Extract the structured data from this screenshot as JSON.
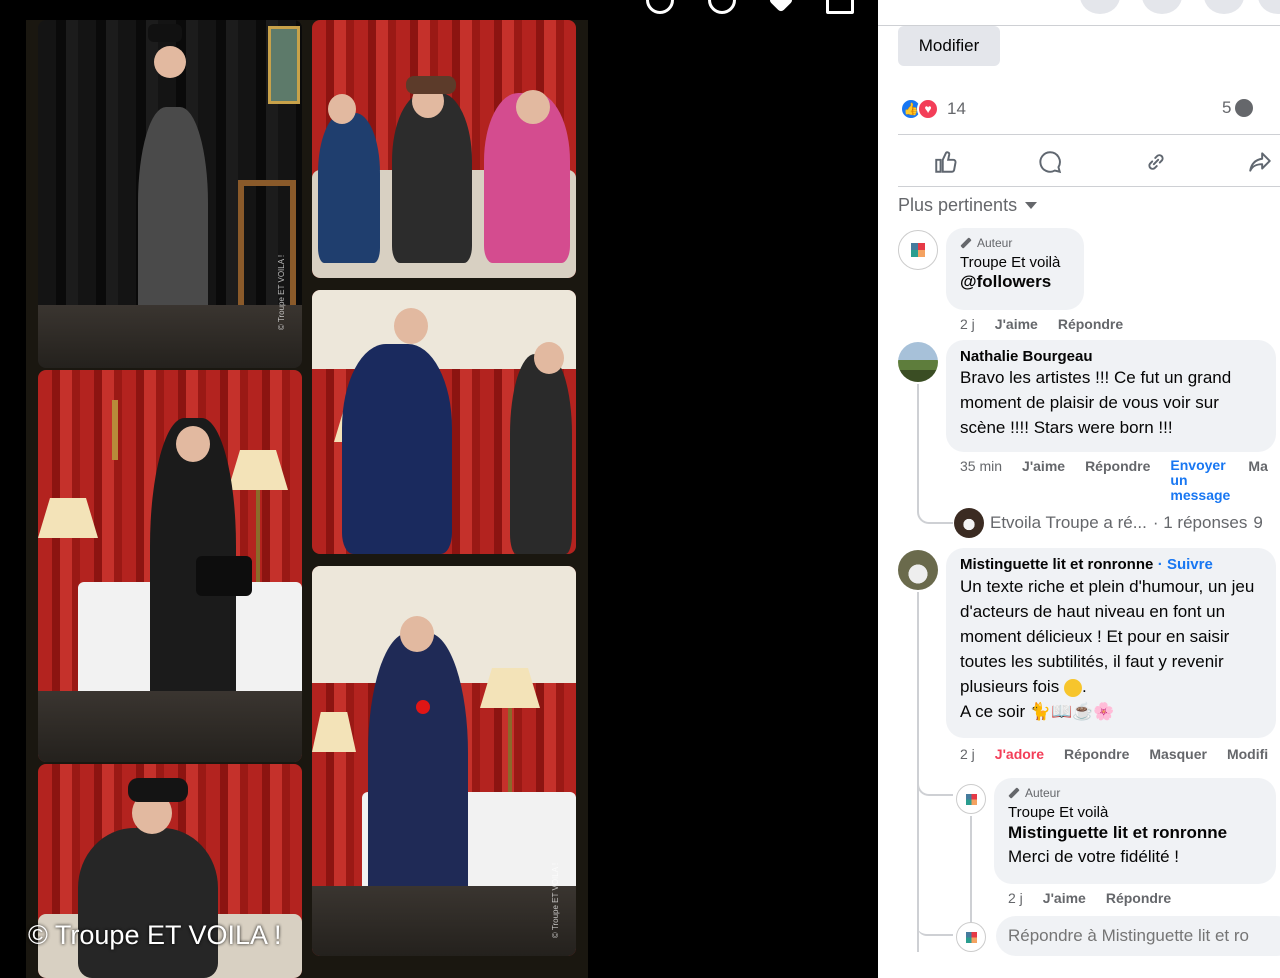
{
  "viewer": {
    "watermark": "© Troupe ET VOILA !",
    "photo_credit": "© Troupe ET VOILA !"
  },
  "post": {
    "edit_label": "Modifier",
    "reaction_count": "14",
    "comment_count": "5",
    "sort_label": "Plus pertinents"
  },
  "comments": [
    {
      "author_badge": "Auteur",
      "name": "Troupe Et voilà",
      "text": "@followers",
      "time": "2 j",
      "like": "J'aime",
      "reply": "Répondre"
    },
    {
      "name": "Nathalie Bourgeau",
      "text": "Bravo les artistes !!! Ce fut un grand moment de plaisir de vous voir sur scène !!!! Stars were born !!!",
      "time": "35 min",
      "like": "J'aime",
      "reply": "Répondre",
      "send": "Envoyer un message",
      "more": "Ma"
    },
    {
      "name": "Mistinguette lit et ronronne",
      "follow": "· Suivre",
      "text": "Un texte riche et plein d'humour, un jeu d'acteurs de haut niveau en font un moment délicieux ! Et pour en saisir toutes les subtilités, il faut y revenir plusieurs fois",
      "text_end": ".",
      "text2": "A ce soir 🐈📖☕🌸",
      "time": "2 j",
      "like": "J'adore",
      "reply": "Répondre",
      "hide": "Masquer",
      "edit": "Modifi"
    }
  ],
  "replies_summary": {
    "name": "Etvoila Troupe a ré...",
    "count": "· 1 réponses",
    "overflow": "9"
  },
  "reply": {
    "author_badge": "Auteur",
    "name": "Troupe Et voilà",
    "mention": "Mistinguette lit et ronronne",
    "text": "Merci de votre fidélité !",
    "time": "2 j",
    "like": "J'aime",
    "reply": "Répondre"
  },
  "reply_input": {
    "placeholder": "Répondre à Mistinguette lit et ro"
  },
  "colors": {
    "accent": "#1877f2",
    "love": "#f33e58"
  }
}
